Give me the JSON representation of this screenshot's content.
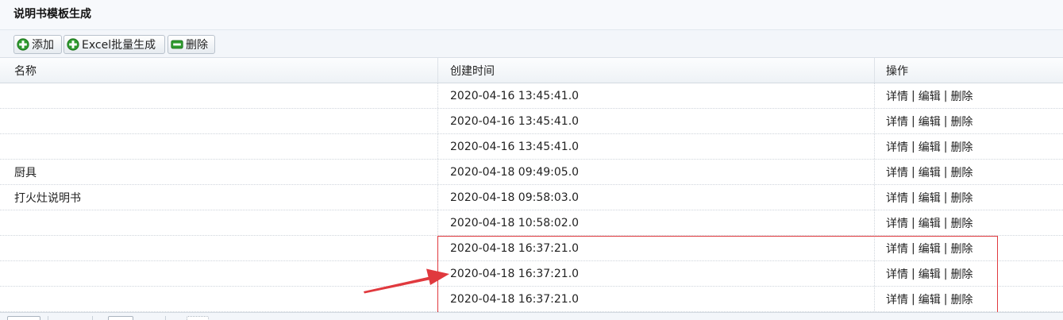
{
  "page": {
    "title": "说明书模板生成"
  },
  "toolbar": {
    "add_label": "添加",
    "excel_label": "Excel批量生成",
    "delete_label": "删除"
  },
  "table": {
    "columns": [
      "名称",
      "创建时间",
      "操作"
    ],
    "actions": {
      "detail": "详情",
      "edit": "编辑",
      "delete": "删除",
      "separator": "|"
    },
    "rows": [
      {
        "name": "",
        "created": "2020-04-16 13:45:41.0"
      },
      {
        "name": "",
        "created": "2020-04-16 13:45:41.0"
      },
      {
        "name": "",
        "created": "2020-04-16 13:45:41.0"
      },
      {
        "name": "厨具",
        "created": "2020-04-18 09:49:05.0"
      },
      {
        "name": "打火灶说明书",
        "created": "2020-04-18 09:58:03.0"
      },
      {
        "name": "",
        "created": "2020-04-18 10:58:02.0"
      },
      {
        "name": "",
        "created": "2020-04-18 16:37:21.0"
      },
      {
        "name": "",
        "created": "2020-04-18 16:37:21.0"
      },
      {
        "name": "",
        "created": "2020-04-18 16:37:21.0"
      }
    ]
  },
  "annotation": {
    "color": "#e0393e"
  },
  "icons": {
    "add": "plus-icon",
    "excel": "plus-icon",
    "delete": "minus-icon"
  },
  "colors": {
    "add_icon": "#2e9a2e",
    "delete_icon": "#2e9a2e"
  }
}
